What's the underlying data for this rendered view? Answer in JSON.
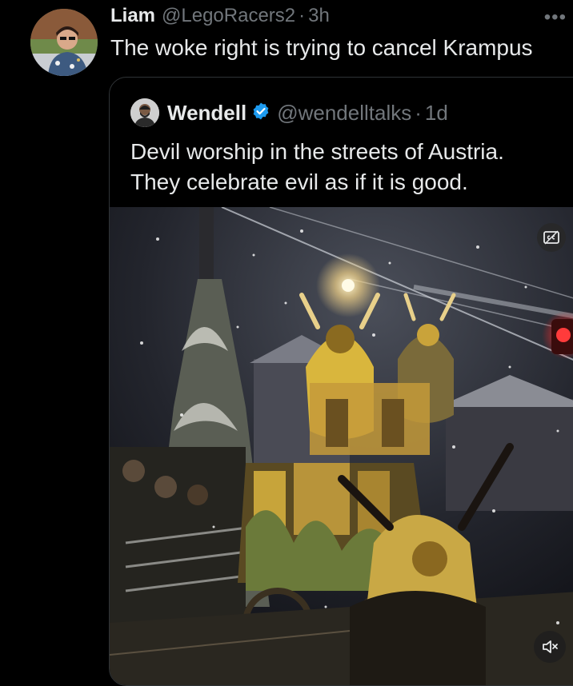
{
  "tweet": {
    "author_name": "Liam",
    "author_handle": "@LegoRacers2",
    "separator": "·",
    "time": "3h",
    "more_label": "•••",
    "text": "The woke right is trying to cancel Krampus"
  },
  "quoted": {
    "author_name": "Wendell",
    "author_handle": "@wendelltalks",
    "separator": "·",
    "time": "1d",
    "text_lines": [
      "Devil worship in the streets of Austria.",
      "They celebrate evil as if it is good."
    ],
    "verified_color": "#1d9bf0"
  },
  "media": {
    "captions_icon": "closed-captions-icon",
    "mute_icon": "speaker-muted-icon"
  },
  "colors": {
    "background": "#000000",
    "primary_text": "#e7e9ea",
    "secondary_text": "#71767b",
    "border": "#2f3336"
  }
}
